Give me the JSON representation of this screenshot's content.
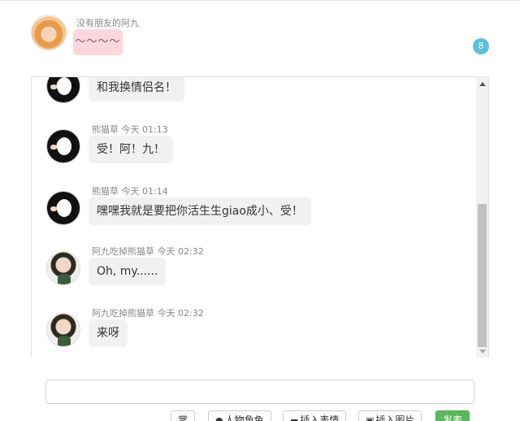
{
  "pinned": {
    "name": "没有朋友的阿九",
    "text": "～～～～",
    "badge": "8"
  },
  "messages": [
    {
      "id": "m0",
      "avatar": "dark",
      "meta": "",
      "text": "和我换情侣名！"
    },
    {
      "id": "m1",
      "avatar": "dark",
      "meta": "熊猫草 今天 01:13",
      "text": "受！阿！九！"
    },
    {
      "id": "m2",
      "avatar": "dark",
      "meta": "熊猫草 今天 01:14",
      "text": "嘿嘿我就是要把你活生生giao成小、受！"
    },
    {
      "id": "m3",
      "avatar": "boy",
      "meta": "阿九吃掉熊猫草 今天 02:32",
      "text": "Oh, my......"
    },
    {
      "id": "m4",
      "avatar": "boy",
      "meta": "阿九吃掉熊猫草 今天 02:32",
      "text": "来呀"
    }
  ],
  "composer": {
    "value": "",
    "placeholder": ""
  },
  "toolbar": {
    "dice": "掌",
    "character": "人物角色",
    "emoji": "插入表情",
    "image": "插入图片",
    "send": "发表"
  },
  "colors": {
    "badge": "#5bc0de",
    "send": "#5cb85c",
    "pinned_bubble": "#ffd6dd"
  }
}
